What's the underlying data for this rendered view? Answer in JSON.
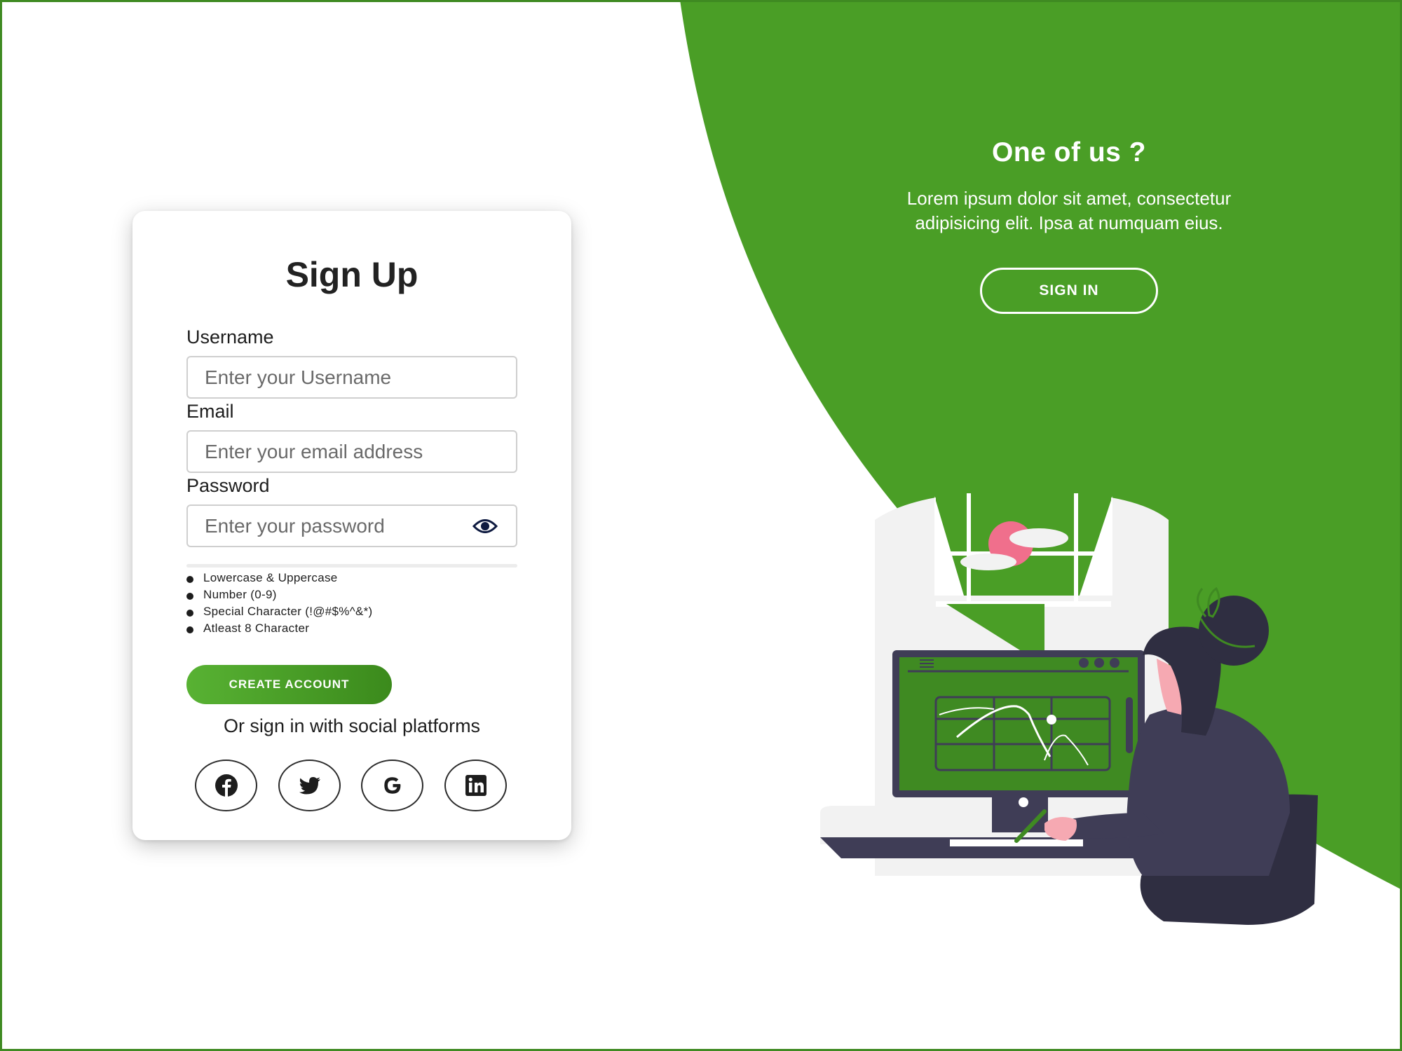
{
  "hero": {
    "title": "One of us ?",
    "text_line1": "Lorem ipsum dolor sit amet, consectetur",
    "text_line2": "adipisicing elit. Ipsa at numquam eius.",
    "sign_in_label": "SIGN IN"
  },
  "form": {
    "title": "Sign Up",
    "username_label": "Username",
    "username_placeholder": "Enter your Username",
    "email_label": "Email",
    "email_placeholder": "Enter your email address",
    "password_label": "Password",
    "password_placeholder": "Enter your password",
    "password_rules": [
      "Lowercase & Uppercase",
      "Number (0-9)",
      "Special Character (!@#$%^&*)",
      "Atleast 8 Character"
    ],
    "create_account_label": "CREATE ACCOUNT",
    "social_text": "Or sign in with social platforms"
  },
  "social_icons": [
    "facebook-icon",
    "twitter-icon",
    "google-icon",
    "linkedin-icon"
  ],
  "colors": {
    "accent": "#4a9e26",
    "accent_dark": "#3b8a1c",
    "text": "#1f1f1f",
    "illustration_dark": "#3f3d56",
    "illustration_pink": "#f06f8c"
  }
}
